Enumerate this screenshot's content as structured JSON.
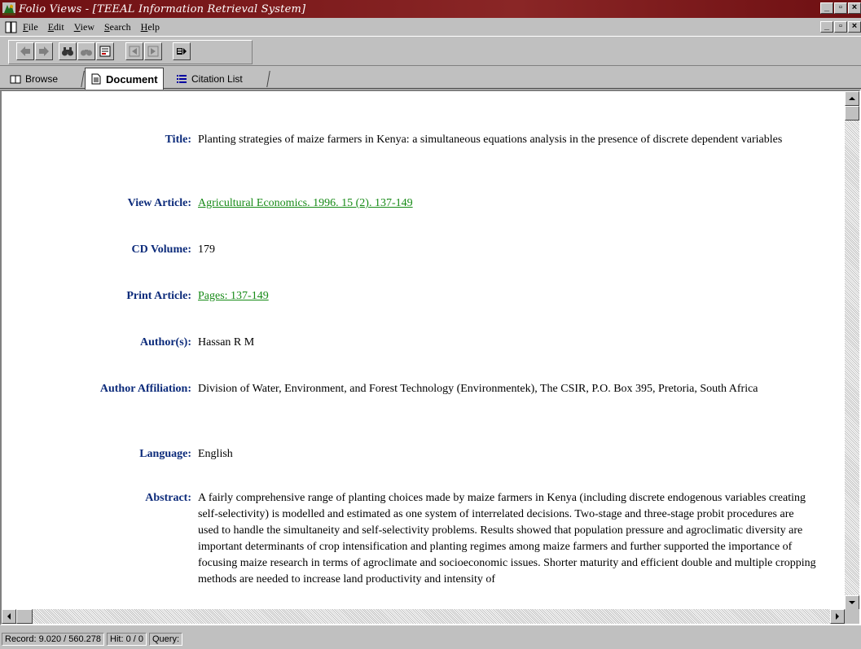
{
  "window": {
    "title": "Folio Views - [TEEAL Information Retrieval System]"
  },
  "menu": [
    "File",
    "Edit",
    "View",
    "Search",
    "Help"
  ],
  "tabs": {
    "browse": "Browse",
    "document": "Document",
    "citation_list": "Citation List"
  },
  "record": {
    "title_label": "Title:",
    "title_value": "Planting strategies of maize farmers in Kenya: a simultaneous equations analysis in the presence of discrete dependent variables",
    "view_article_label": "View Article:",
    "view_article_value": " Agricultural Economics. 1996. 15 (2). 137-149",
    "cd_volume_label": "CD Volume:",
    "cd_volume_value": "179",
    "print_article_label": "Print Article:",
    "print_article_value": " Pages: 137-149",
    "authors_label": "Author(s):",
    "authors_value": "Hassan R M",
    "affiliation_label": "Author Affiliation:",
    "affiliation_value": "Division of Water, Environment, and Forest Technology (Environmentek), The CSIR, P.O. Box 395, Pretoria, South Africa",
    "language_label": "Language:",
    "language_value": "English",
    "abstract_label": "Abstract:",
    "abstract_value": "A fairly comprehensive range of planting choices made by maize farmers in Kenya (including discrete endogenous variables creating self-selectivity) is modelled and estimated as one system of interrelated decisions. Two-stage and three-stage probit procedures are used to handle the simultaneity and self-selectivity problems. Results showed that population pressure and agroclimatic diversity are important determinants of crop intensification and planting regimes among maize farmers and further supported the importance of focusing maize research in terms of agroclimate and socioeconomic issues.  Shorter maturity and efficient double and multiple cropping methods are needed to increase land productivity and intensity of"
  },
  "status": {
    "record": "Record: 9.020 / 560.278",
    "hit": "Hit: 0 / 0",
    "query": "Query:"
  },
  "colors": {
    "titlebar": "#7f1d1d",
    "label": "#0b2a7a",
    "link": "#168a16"
  }
}
